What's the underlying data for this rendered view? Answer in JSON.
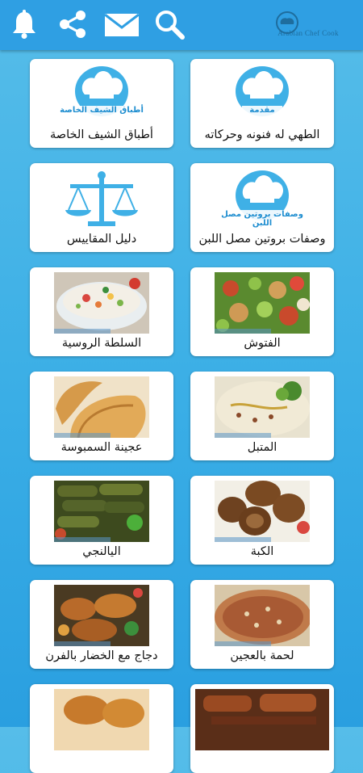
{
  "header": {
    "icons": [
      "bell-icon",
      "share-icon",
      "mail-icon",
      "search-icon"
    ],
    "logo_text": "Arabian Chef Cook",
    "color": "#2f9fe3"
  },
  "cards": [
    {
      "label": "أطباق الشيف الخاصة",
      "badge": "أطباق الشيف الخاصة",
      "kind": "chef-logo"
    },
    {
      "label": "الطهي له فنونه وحركاته",
      "badge": "مقدمة",
      "kind": "chef-logo"
    },
    {
      "label": "دليل المقاييس",
      "kind": "scales"
    },
    {
      "label": "وصفات بروتين مصل اللبن",
      "badge": "وصفات بروتين مصل اللبن",
      "kind": "chef-logo"
    },
    {
      "label": "السلطة الروسية",
      "kind": "photo"
    },
    {
      "label": "الفتوش",
      "kind": "photo"
    },
    {
      "label": "عجينة السمبوسة",
      "kind": "photo"
    },
    {
      "label": "المتبل",
      "kind": "photo"
    },
    {
      "label": "اليالنجي",
      "kind": "photo"
    },
    {
      "label": "الكبة",
      "kind": "photo"
    },
    {
      "label": "دجاج مع الخضار بالفرن",
      "kind": "photo"
    },
    {
      "label": "لحمة بالعجين",
      "kind": "photo"
    },
    {
      "label": "",
      "kind": "photo"
    },
    {
      "label": "",
      "kind": "photo"
    }
  ]
}
